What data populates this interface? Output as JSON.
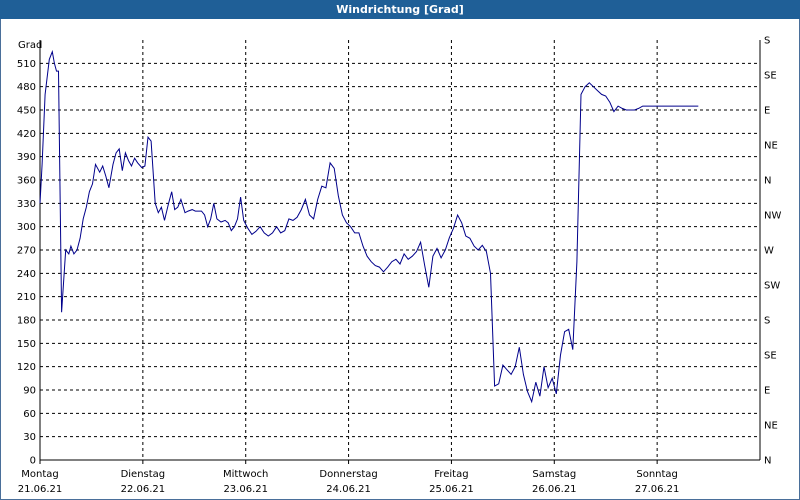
{
  "window": {
    "title": "Windrichtung [Grad]"
  },
  "chart_data": {
    "type": "line",
    "title": "Windrichtung [Grad]",
    "ylabel": "Grad",
    "ylim": [
      0,
      540
    ],
    "y_ticks": [
      0,
      30,
      60,
      90,
      120,
      150,
      180,
      210,
      240,
      270,
      300,
      330,
      360,
      390,
      420,
      450,
      480,
      510
    ],
    "right_ticks": [
      {
        "value": 0,
        "label": "N"
      },
      {
        "value": 45,
        "label": "NE"
      },
      {
        "value": 90,
        "label": "E"
      },
      {
        "value": 135,
        "label": "SE"
      },
      {
        "value": 180,
        "label": "S"
      },
      {
        "value": 225,
        "label": "SW"
      },
      {
        "value": 270,
        "label": "W"
      },
      {
        "value": 315,
        "label": "NW"
      },
      {
        "value": 360,
        "label": "N"
      },
      {
        "value": 405,
        "label": "NE"
      },
      {
        "value": 450,
        "label": "E"
      },
      {
        "value": 495,
        "label": "SE"
      },
      {
        "value": 540,
        "label": "S"
      }
    ],
    "xlim": [
      0,
      7
    ],
    "x_ticks": [
      {
        "value": 0,
        "day": "Montag",
        "date": "21.06.21"
      },
      {
        "value": 1,
        "day": "Dienstag",
        "date": "22.06.21"
      },
      {
        "value": 2,
        "day": "Mittwoch",
        "date": "23.06.21"
      },
      {
        "value": 3,
        "day": "Donnerstag",
        "date": "24.06.21"
      },
      {
        "value": 4,
        "day": "Freitag",
        "date": "25.06.21"
      },
      {
        "value": 5,
        "day": "Samstag",
        "date": "26.06.21"
      },
      {
        "value": 6,
        "day": "Sonntag",
        "date": "27.06.21"
      }
    ],
    "grid": true,
    "color": "#00008b",
    "x": [
      0.0,
      0.02,
      0.05,
      0.09,
      0.12,
      0.14,
      0.16,
      0.18,
      0.21,
      0.25,
      0.28,
      0.3,
      0.33,
      0.36,
      0.39,
      0.42,
      0.45,
      0.48,
      0.51,
      0.54,
      0.58,
      0.61,
      0.64,
      0.67,
      0.71,
      0.74,
      0.77,
      0.8,
      0.83,
      0.86,
      0.89,
      0.92,
      0.95,
      0.99,
      1.02,
      1.05,
      1.08,
      1.12,
      1.15,
      1.18,
      1.21,
      1.25,
      1.28,
      1.31,
      1.34,
      1.37,
      1.41,
      1.44,
      1.48,
      1.51,
      1.54,
      1.57,
      1.6,
      1.63,
      1.66,
      1.69,
      1.72,
      1.76,
      1.8,
      1.83,
      1.86,
      1.89,
      1.92,
      1.95,
      1.98,
      2.02,
      2.06,
      2.1,
      2.14,
      2.18,
      2.22,
      2.26,
      2.3,
      2.34,
      2.38,
      2.42,
      2.46,
      2.5,
      2.54,
      2.58,
      2.62,
      2.66,
      2.7,
      2.74,
      2.78,
      2.82,
      2.86,
      2.9,
      2.94,
      2.98,
      3.02,
      3.06,
      3.1,
      3.14,
      3.18,
      3.22,
      3.26,
      3.3,
      3.34,
      3.38,
      3.42,
      3.46,
      3.5,
      3.54,
      3.58,
      3.62,
      3.66,
      3.7,
      3.74,
      3.78,
      3.82,
      3.86,
      3.9,
      3.94,
      3.98,
      4.02,
      4.06,
      4.1,
      4.14,
      4.18,
      4.22,
      4.26,
      4.3,
      4.34,
      4.38,
      4.42,
      4.46,
      4.5,
      4.54,
      4.58,
      4.62,
      4.66,
      4.7,
      4.74,
      4.78,
      4.82,
      4.86,
      4.9,
      4.94,
      4.98,
      5.02,
      5.06,
      5.1,
      5.14,
      5.18,
      5.22,
      5.26,
      5.3,
      5.34,
      5.38,
      5.42,
      5.46,
      5.5,
      5.54,
      5.58,
      5.62,
      5.66,
      5.7,
      5.74,
      5.78,
      5.82,
      5.86,
      5.9,
      5.94,
      5.98,
      6.0,
      6.02,
      6.05,
      6.08,
      6.12,
      6.16,
      6.2,
      6.25,
      6.3,
      6.35,
      6.4,
      6.45,
      6.5
    ],
    "y": [
      330,
      380,
      470,
      515,
      525,
      510,
      500,
      500,
      190,
      270,
      265,
      275,
      265,
      270,
      285,
      310,
      325,
      345,
      355,
      380,
      370,
      378,
      365,
      350,
      380,
      395,
      400,
      372,
      395,
      385,
      378,
      388,
      382,
      376,
      378,
      415,
      410,
      330,
      318,
      325,
      308,
      330,
      345,
      322,
      325,
      335,
      318,
      320,
      322,
      320,
      320,
      320,
      315,
      300,
      310,
      330,
      310,
      306,
      308,
      305,
      295,
      300,
      310,
      338,
      308,
      298,
      290,
      294,
      300,
      292,
      288,
      292,
      300,
      292,
      295,
      310,
      308,
      312,
      322,
      335,
      315,
      310,
      335,
      352,
      350,
      382,
      375,
      340,
      315,
      305,
      300,
      292,
      292,
      275,
      262,
      255,
      250,
      248,
      242,
      248,
      255,
      258,
      252,
      265,
      258,
      262,
      268,
      280,
      250,
      222,
      262,
      272,
      260,
      270,
      286,
      298,
      315,
      305,
      288,
      285,
      275,
      270,
      276,
      268,
      240,
      95,
      98,
      122,
      116,
      110,
      120,
      145,
      110,
      88,
      75,
      100,
      82,
      120,
      93,
      105,
      85,
      135,
      165,
      168,
      142,
      255,
      470,
      480,
      485,
      480,
      475,
      470,
      468,
      460,
      448,
      455,
      452,
      450,
      450,
      450,
      452,
      455,
      455,
      455,
      455,
      455,
      455,
      455,
      455,
      455,
      455,
      455,
      455,
      455,
      455,
      455
    ]
  }
}
